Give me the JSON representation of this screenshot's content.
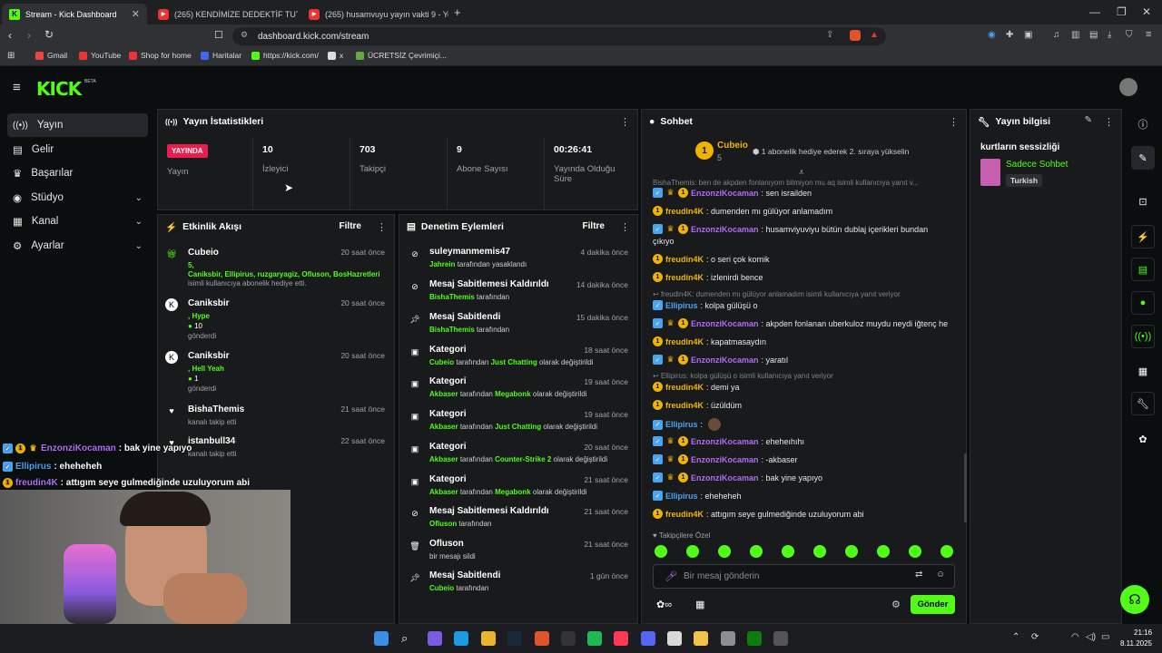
{
  "browser": {
    "tabs": [
      {
        "title": "Stream - Kick Dashboard"
      },
      {
        "title": "(265) KENDİMİZE DEDEKTİF TUTTUK"
      },
      {
        "title": "(265) husamvuyu yayın vakti 9 - YouT"
      }
    ],
    "url": "dashboard.kick.com/stream",
    "bookmarks": [
      "Gmail",
      "YouTube",
      "Shop for home",
      "Haritalar",
      "https://kick.com/",
      "x",
      "ÜCRETSİZ Çevrimiçi..."
    ]
  },
  "app": {
    "logo": "KICK",
    "beta": "BETA"
  },
  "sidebar": {
    "items": [
      {
        "label": "Yayın"
      },
      {
        "label": "Gelir"
      },
      {
        "label": "Başarılar"
      },
      {
        "label": "Stüdyo"
      },
      {
        "label": "Kanal"
      },
      {
        "label": "Ayarlar"
      }
    ]
  },
  "stats": {
    "title": "Yayın İstatistikleri",
    "live_badge": "YAYINDA",
    "live_label": "Yayın",
    "items": [
      {
        "value": "10",
        "label": "İzleyici"
      },
      {
        "value": "703",
        "label": "Takipçi"
      },
      {
        "value": "9",
        "label": "Abone Sayısı"
      },
      {
        "value": "00:26:41",
        "label": "Yayında Olduğu Süre"
      }
    ]
  },
  "activity": {
    "title": "Etkinlik Akışı",
    "filter": "Filtre",
    "items": [
      {
        "name": "Cubeio",
        "time": "20 saat önce",
        "line1": "5,",
        "line2": "Caniksbir, Ellipirus, ruzgaryagiz, Ofluson, BosHazretleri",
        "line3": "isimli kullanıcıya abonelik hediye etti."
      },
      {
        "name": "Caniksbir",
        "time": "20 saat önce",
        "line1": ", Hype",
        "line2": "10",
        "line3": "gönderdi"
      },
      {
        "name": "Caniksbir",
        "time": "20 saat önce",
        "line1": ", Hell Yeah",
        "line2": "1",
        "line3": "gönderdi"
      },
      {
        "name": "BishaThemis",
        "time": "21 saat önce",
        "line1": "kanalı takip etti"
      },
      {
        "name": "istanbull34",
        "time": "22 saat önce",
        "line1": "kanalı takip etti"
      }
    ]
  },
  "moderation": {
    "title": "Denetim Eylemleri",
    "filter": "Filtre",
    "items": [
      {
        "name": "suleymanmemis47",
        "time": "4 dakika önce",
        "actor": "Jahrein",
        "rest": "tarafından yasaklandı"
      },
      {
        "name": "Mesaj Sabitlemesi Kaldırıldı",
        "time": "14 dakika önce",
        "actor": "BishaThemis",
        "rest": "tarafından"
      },
      {
        "name": "Mesaj Sabitlendi",
        "time": "15 dakika önce",
        "actor": "BishaThemis",
        "rest": "tarafından"
      },
      {
        "name": "Kategori",
        "time": "18 saat önce",
        "actor": "Cubeio",
        "mid": "tarafından",
        "cat": "Just Chatting",
        "rest": "olarak değiştirildi"
      },
      {
        "name": "Kategori",
        "time": "19 saat önce",
        "actor": "Akbaser",
        "mid": "tarafından",
        "cat": "Megabonk",
        "rest": "olarak değiştirildi"
      },
      {
        "name": "Kategori",
        "time": "19 saat önce",
        "actor": "Akbaser",
        "mid": "tarafından",
        "cat": "Just Chatting",
        "rest": "olarak değiştirildi"
      },
      {
        "name": "Kategori",
        "time": "20 saat önce",
        "actor": "Akbaser",
        "mid": "tarafından",
        "cat": "Counter-Strike 2",
        "rest": "olarak değiştirildi"
      },
      {
        "name": "Kategori",
        "time": "21 saat önce",
        "actor": "Akbaser",
        "mid": "tarafından",
        "cat": "Megabonk",
        "rest": "olarak değiştirildi"
      },
      {
        "name": "Mesaj Sabitlemesi Kaldırıldı",
        "time": "21 saat önce",
        "actor": "Ofluson",
        "rest": "tarafından"
      },
      {
        "name": "Ofluson",
        "time": "21 saat önce",
        "plain": "bir mesajı sildi"
      },
      {
        "name": "Mesaj Sabitlendi",
        "time": "1 gün önce",
        "actor": "Cubeio",
        "rest": "tarafından"
      }
    ]
  },
  "chat": {
    "title": "Sohbet",
    "pinned_user": "Cubeio",
    "pinned_count": "5",
    "pinned_text": "1 abonelik hediye ederek 2. sıraya yükselin",
    "top_reply": "BishaThemis: ben de akpden fonlanıyom bilmiyon mu aq isimli kullanıcıya yanıt v...",
    "messages": [
      {
        "user": "EnzonziKocaman",
        "text": ": sen israilden",
        "style": "p"
      },
      {
        "user": "freudin4K",
        "text": ": dumenden mı gülüyor anlamadım",
        "style": "o"
      },
      {
        "user": "EnzonziKocaman",
        "text": ": husamviyuviyu bütün dublaj içerikleri bundan",
        "style": "p"
      },
      {
        "user": "",
        "text": "çıkıyo",
        "style": "cont"
      },
      {
        "user": "freudin4K",
        "text": ": o seri çok komik",
        "style": "o"
      },
      {
        "user": "freudin4K",
        "text": ": izlenirdi bence",
        "style": "o"
      },
      {
        "user": "",
        "text": "freudin4K: dumenden mı gülüyor anlamadım isimli kullanıcıya yanıt veriyor",
        "style": "reply"
      },
      {
        "user": "Ellipirus",
        "text": ": kolpa gülüşü o",
        "style": "b"
      },
      {
        "user": "EnzonziKocaman",
        "text": ": akpden fonlanan uberkuloz muydu neydi iğtenç he",
        "style": "p"
      },
      {
        "user": "freudin4K",
        "text": ": kapatmasaydın",
        "style": "o"
      },
      {
        "user": "EnzonziKocaman",
        "text": ": yaratıl",
        "style": "p"
      },
      {
        "user": "",
        "text": "Ellipirus: kolpa gülüşü o isimli kullanıcıya yanıt veriyor",
        "style": "reply"
      },
      {
        "user": "freudin4K",
        "text": ": demi ya",
        "style": "o"
      },
      {
        "user": "freudin4K",
        "text": ": üzüldüm",
        "style": "o"
      },
      {
        "user": "Ellipirus",
        "text": ":",
        "style": "b"
      },
      {
        "user": "EnzonziKocaman",
        "text": ": eheheıhıhı",
        "style": "p"
      },
      {
        "user": "EnzonziKocaman",
        "text": ": -akbaser",
        "style": "p"
      },
      {
        "user": "EnzonziKocaman",
        "text": ": bak yine yapıyo",
        "style": "p"
      },
      {
        "user": "Ellipirus",
        "text": ": eheheheh",
        "style": "b"
      },
      {
        "user": "freudin4K",
        "text": ": attıgım seye gulmediğinde uzuluyorum abi",
        "style": "o"
      }
    ],
    "followers_only": "Takipçilere Özel",
    "input_placeholder": "Bir mesaj gönderin",
    "send": "Gönder"
  },
  "stream_info": {
    "title": "Yayın bilgisi",
    "stream_title": "kurtların sessizliği",
    "category": "Sadece Sohbet",
    "language": "Turkish"
  },
  "overlay": {
    "lines": [
      {
        "user": "EnzonziKocaman",
        "text": ": bak yine yapıyo"
      },
      {
        "user": "Ellipirus",
        "text": ": eheheheh"
      },
      {
        "user": "freudin4K",
        "text": ": attıgım seye gulmediğinde uzuluyorum abi"
      }
    ]
  },
  "taskbar": {
    "time": "21:16",
    "date": "8.11.2025"
  },
  "colors": {
    "accent": "#53fc18",
    "live": "#e91e4f",
    "panel": "#181a1b",
    "bg": "#0b0e0f"
  }
}
